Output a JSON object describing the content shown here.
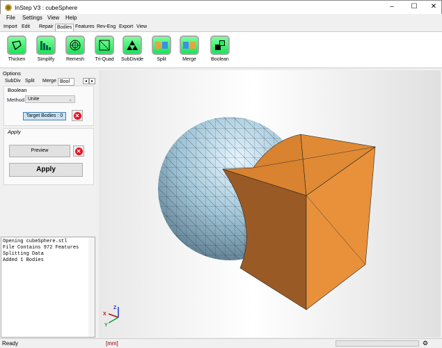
{
  "window": {
    "title": "InStep V3 : cubeSphere",
    "controls": [
      "–",
      "☐",
      "✕"
    ]
  },
  "menu": [
    "File",
    "Settings",
    "View",
    "Help"
  ],
  "ribbon_tabs": [
    "Import",
    "Edit",
    "Repair",
    "Bodies",
    "Features",
    "Rev-Eng",
    "Export",
    "View"
  ],
  "active_tab": "Bodies",
  "tools": [
    {
      "label": "Thicken",
      "icon": "thicken-icon"
    },
    {
      "label": "Simplify",
      "icon": "simplify-icon"
    },
    {
      "label": "Remesh",
      "icon": "remesh-icon"
    },
    {
      "label": "Tri-Quad",
      "icon": "tri-quad-icon"
    },
    {
      "label": "SubDivide",
      "icon": "subdivide-icon"
    },
    {
      "label": "Split",
      "icon": "split-icon"
    },
    {
      "label": "Merge",
      "icon": "merge-icon"
    },
    {
      "label": "Boolean",
      "icon": "boolean-icon"
    }
  ],
  "options": {
    "title": "Options",
    "tabs": [
      "SubDiv",
      "Split",
      "Merge",
      "Bool"
    ],
    "active_tab": "Bool",
    "boolean": {
      "title": "Boolean",
      "method_label": "Method",
      "method_value": "Unite",
      "target_label": "Target Bodies : 0"
    },
    "apply": {
      "title": "Apply",
      "preview": "Preview",
      "apply": "Apply"
    }
  },
  "log": [
    "Opening cubeSphere.stl",
    "File Contains 972 Features",
    "Splitting Data",
    "Added 1 Bodies"
  ],
  "axes": {
    "x": "X",
    "y": "Y",
    "z": "Z"
  },
  "status": {
    "text": "Ready",
    "units": "[mm]"
  },
  "colors": {
    "cube": "#e8913a",
    "sphere": "#a9cfe0",
    "tool_green": "#2ee866"
  }
}
